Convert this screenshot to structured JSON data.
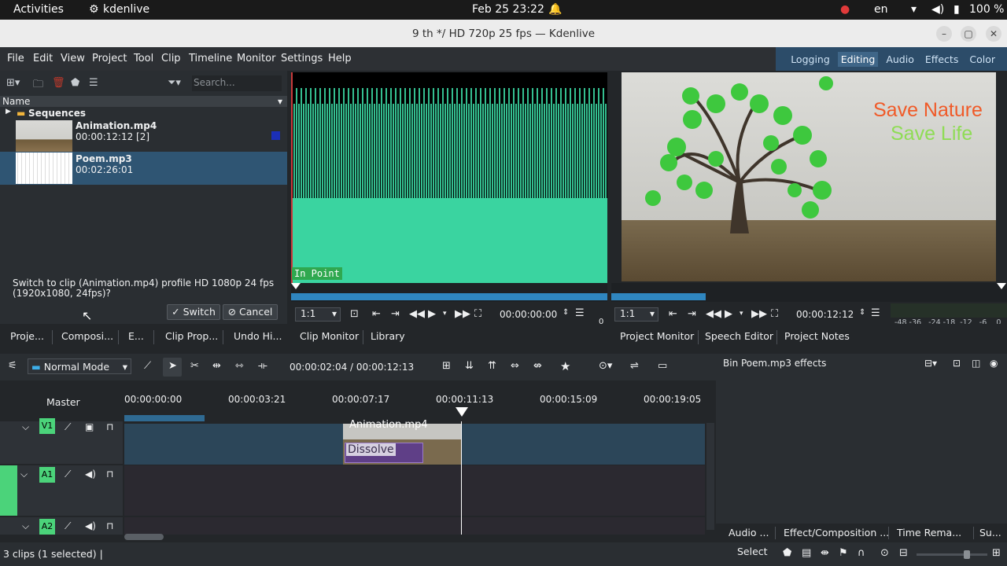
{
  "system_bar": {
    "activities": "Activities",
    "app": "kdenlive",
    "datetime": "Feb 25  23:22",
    "lang": "en",
    "battery": "100 %"
  },
  "window": {
    "title": "9 th */ HD 720p 25 fps — Kdenlive"
  },
  "menu": [
    "File",
    "Edit",
    "View",
    "Project",
    "Tool",
    "Clip",
    "Timeline",
    "Monitor",
    "Settings",
    "Help"
  ],
  "layouts": {
    "items": [
      "Logging",
      "Editing",
      "Audio",
      "Effects",
      "Color"
    ],
    "active": "Editing"
  },
  "bin": {
    "search_placeholder": "Search...",
    "column": "Name",
    "folder": "Sequences",
    "clips": [
      {
        "name": "Animation.mp4",
        "duration": "00:00:12:12 [2]"
      },
      {
        "name": "Poem.mp3",
        "duration": "00:02:26:01"
      }
    ],
    "message": "Switch to clip (Animation.mp4) profile HD 1080p 24 fps (1920x1080, 24fps)?",
    "switch_label": "Switch",
    "cancel_label": "Cancel"
  },
  "left_tabs": [
    "Proje...",
    "Composi...",
    "E...",
    "Clip Prop...",
    "Undo Hi..."
  ],
  "clip_monitor": {
    "in_point": "In Point",
    "zoom": "1:1",
    "timecode": "00:00:00:00",
    "zero": "0"
  },
  "project_monitor": {
    "zoom": "1:1",
    "timecode": "00:00:12:12",
    "text1": "Save Nature",
    "text2": "Save Life",
    "meter_labels": "-48 -36   -24 -18  -12   -6    0"
  },
  "monitor_tabs": {
    "left": [
      "Clip Monitor",
      "Library"
    ],
    "right": [
      "Project Monitor",
      "Speech Editor",
      "Project Notes"
    ]
  },
  "timeline": {
    "mode": "Normal Mode",
    "position": "00:00:02:04 / 00:00:12:13",
    "master": "Master",
    "ruler": [
      "00:00:00:00",
      "00:00:03:21",
      "00:00:07:17",
      "00:00:11:13",
      "00:00:15:09",
      "00:00:19:05"
    ],
    "tracks": [
      "V1",
      "A1",
      "A2"
    ],
    "clip_label": "Animation.mp4",
    "transition": "Dissolve"
  },
  "effects_panel": {
    "title": "Bin Poem.mp3 effects"
  },
  "right_tabs": [
    "Audio ...",
    "Effect/Composition ...",
    "Time Rema...",
    "Su..."
  ],
  "status": {
    "text": "3 clips (1 selected) |",
    "tool": "Select"
  },
  "colors": {
    "accent": "#3daee9",
    "track_green": "#4bd37a",
    "waveform": "#3ad4a0"
  }
}
